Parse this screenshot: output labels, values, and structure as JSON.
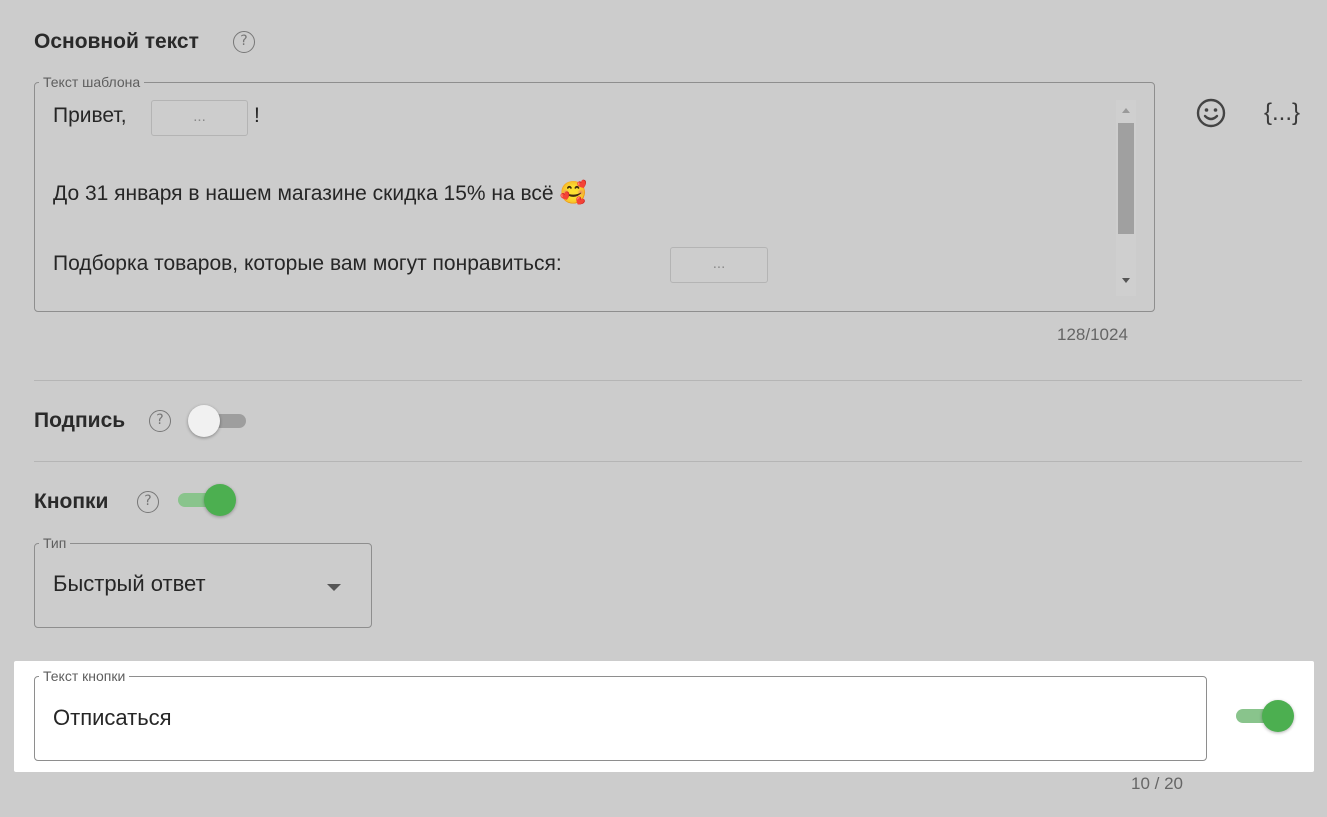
{
  "main_text": {
    "title": "Основной текст",
    "help_glyph": "?",
    "field_label": "Текст шаблона",
    "line1_prefix": "Привет,",
    "line1_suffix": "!",
    "var_placeholder": "...",
    "line2": "До 31 января в нашем магазине скидка 15% на всё",
    "line2_emoji": "🥰",
    "line3": "Подборка товаров, которые вам могут понравиться:",
    "counter": "128/1024",
    "emoji_icon": "smiley-icon",
    "variable_icon_glyph": "{...}"
  },
  "signature": {
    "title": "Подпись",
    "help_glyph": "?",
    "enabled": false
  },
  "buttons": {
    "title": "Кнопки",
    "help_glyph": "?",
    "enabled": true,
    "type_label": "Тип",
    "type_value": "Быстрый ответ",
    "button_text_label": "Текст кнопки",
    "button_text_value": "Отписаться",
    "button_text_counter": "10 / 20",
    "button_enabled": true
  },
  "colors": {
    "toggle_on": "#4caf50",
    "toggle_on_track": "#89c48c",
    "toggle_off_knob": "#f1f1f1",
    "toggle_off_track": "#9e9e9e"
  }
}
